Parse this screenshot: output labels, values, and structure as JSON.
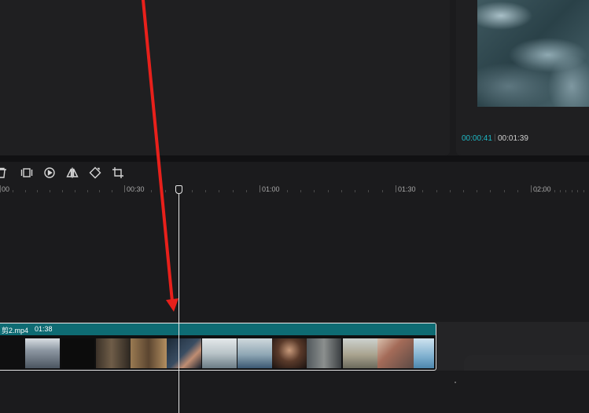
{
  "preview": {
    "current_time": "00:00:41",
    "separator": "|",
    "total_time": "00:01:39"
  },
  "toolbar": {
    "tools": [
      {
        "name": "delete-icon"
      },
      {
        "name": "freeze-frame-icon"
      },
      {
        "name": "play-reverse-icon"
      },
      {
        "name": "mirror-icon"
      },
      {
        "name": "rotate-icon"
      },
      {
        "name": "crop-icon"
      }
    ]
  },
  "ruler": {
    "labels": [
      "00",
      "00:30",
      "01:00",
      "01:30",
      "02:00"
    ]
  },
  "track": {
    "clip_name": "剪2.mp4",
    "clip_duration": "01:38",
    "accent_color": "#0e6b73"
  },
  "annotation": {
    "arrow_color": "#e8201b"
  }
}
